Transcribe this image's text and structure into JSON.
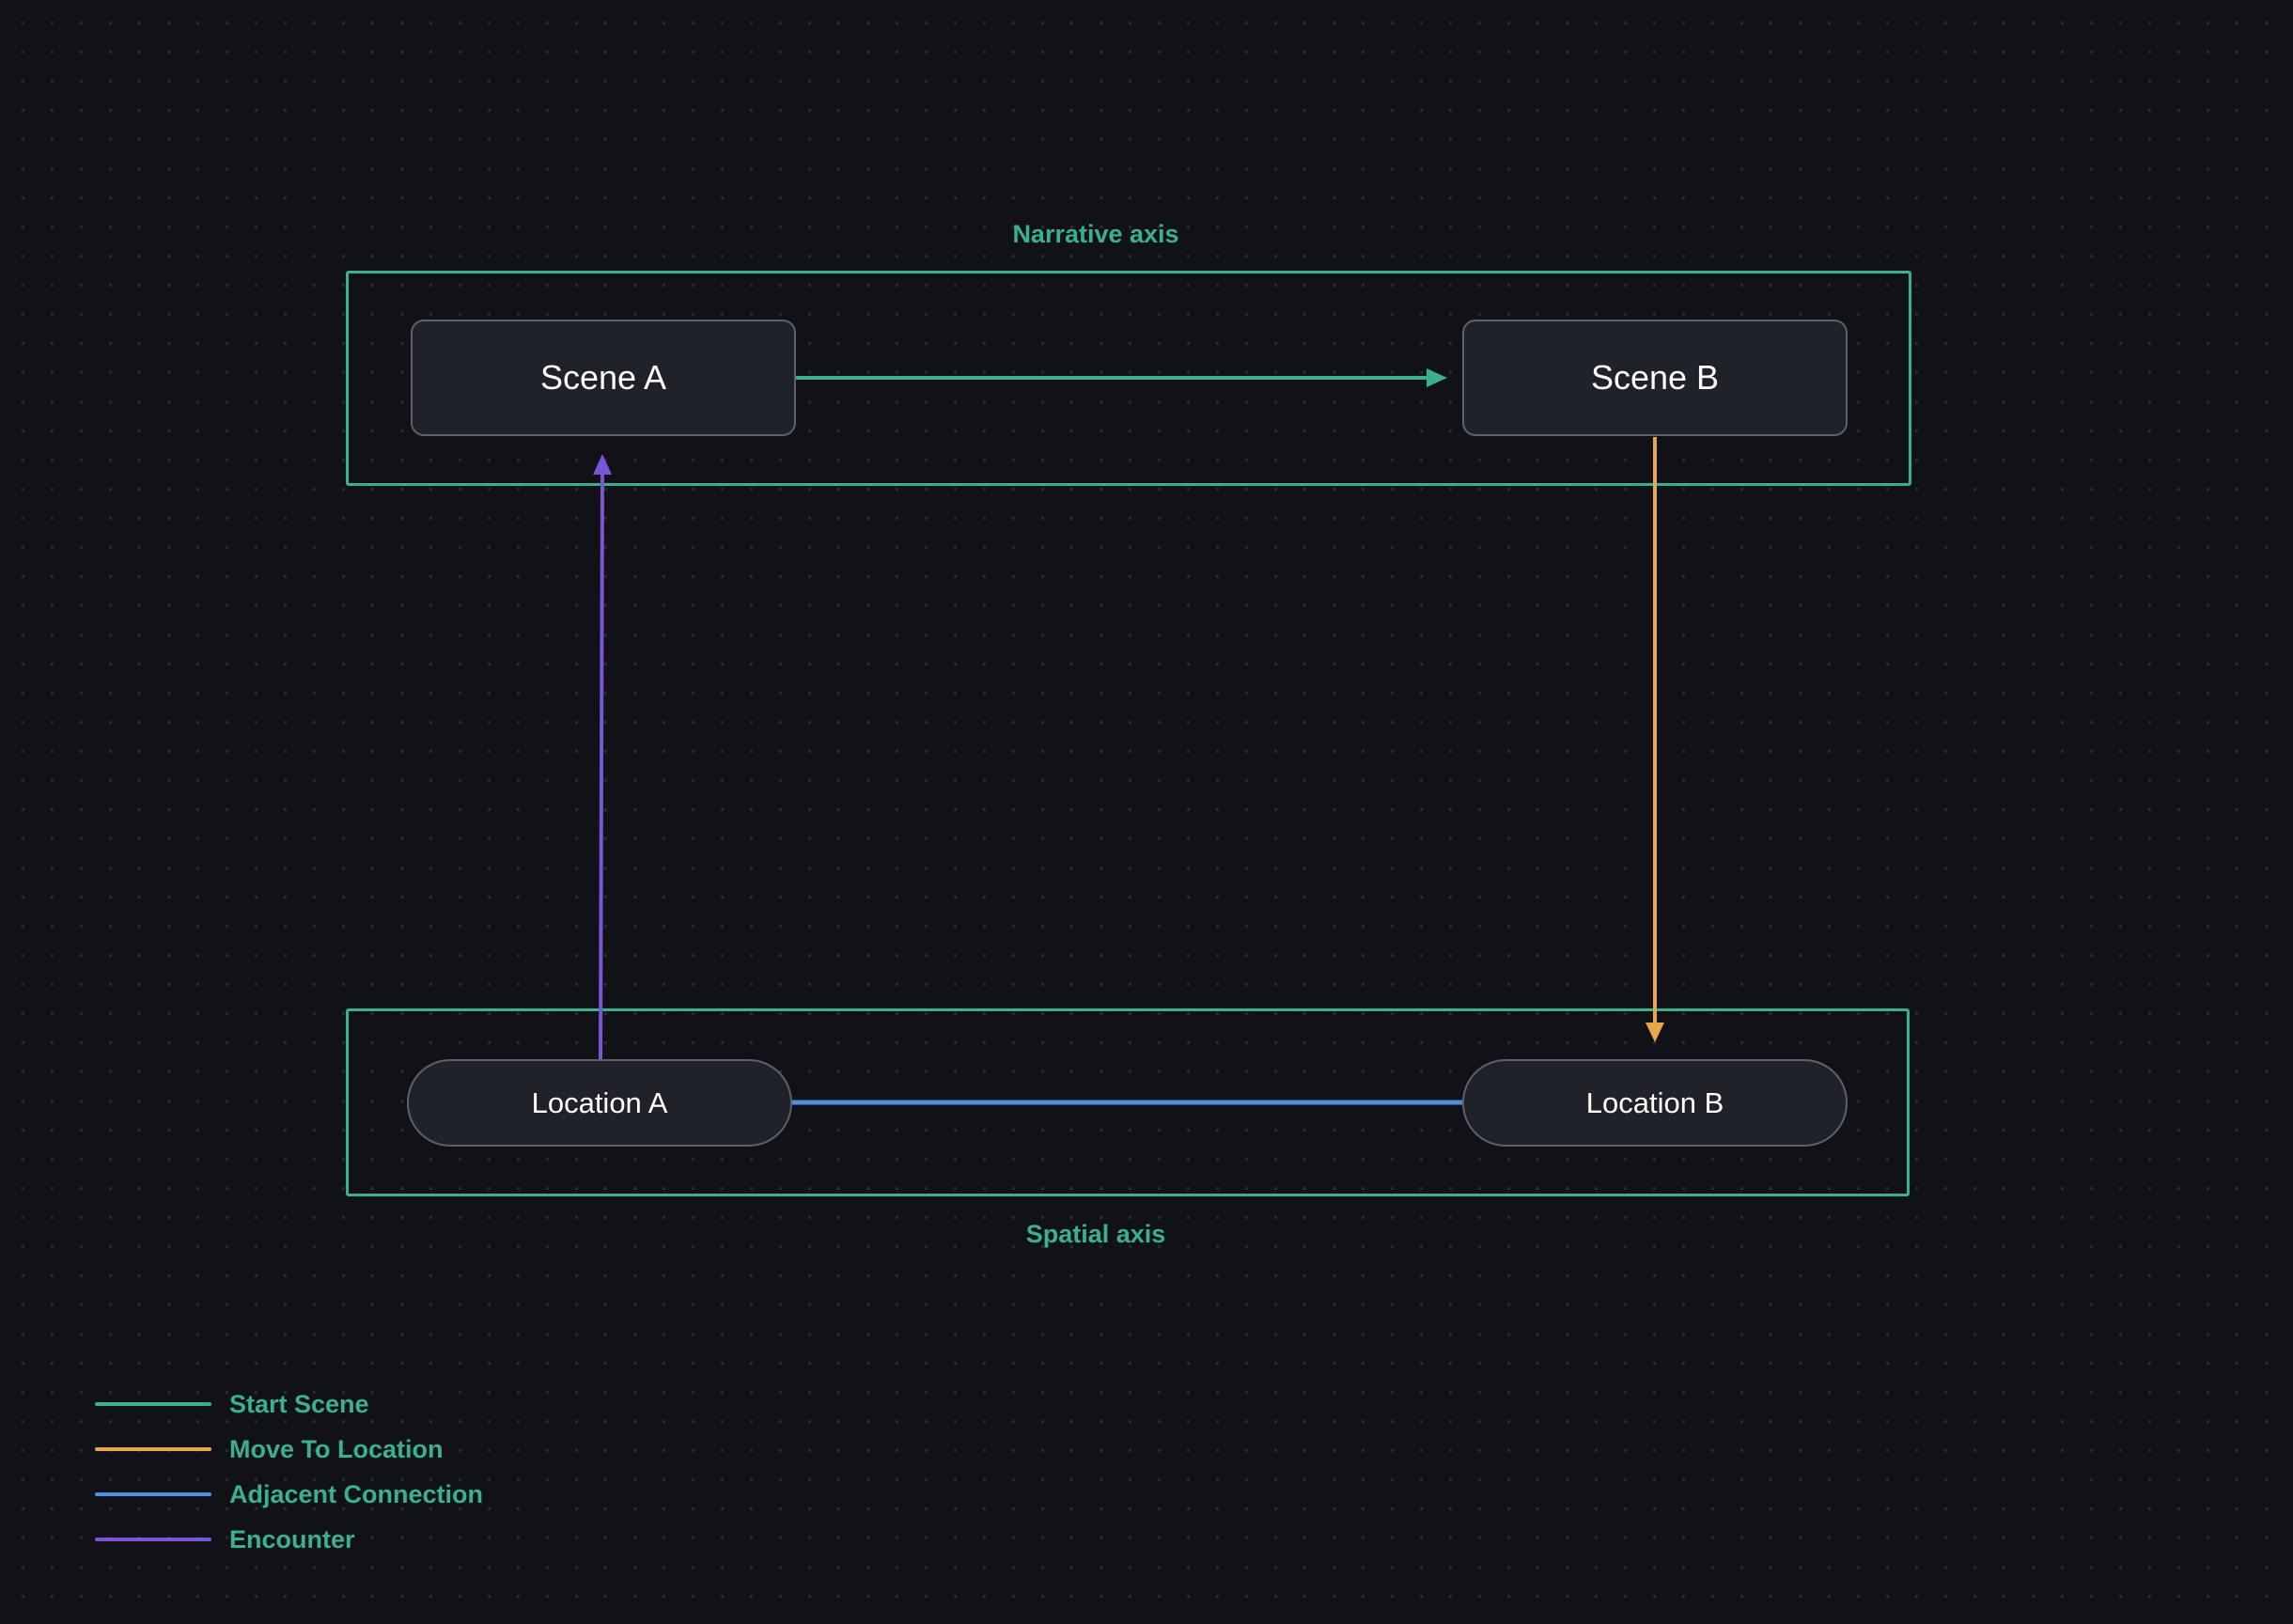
{
  "diagram": {
    "groups": {
      "narrative_label": "Narrative axis",
      "spatial_label": "Spatial axis",
      "border_color": "#3bb08f"
    },
    "nodes": {
      "scene_a": "Scene A",
      "scene_b": "Scene B",
      "location_a": "Location A",
      "location_b": "Location B"
    },
    "edges": [
      {
        "from": "Scene A",
        "to": "Scene B",
        "type": "Start Scene",
        "color": "#3bb08f",
        "arrow": true
      },
      {
        "from": "Scene B",
        "to": "Location B",
        "type": "Move To Location",
        "color": "#e8a54b",
        "arrow": true
      },
      {
        "from": "Location A",
        "to": "Location B",
        "type": "Adjacent Connection",
        "color": "#4f8fdf",
        "arrow": false
      },
      {
        "from": "Location A",
        "to": "Scene A",
        "type": "Encounter",
        "color": "#7b55d6",
        "arrow": true
      }
    ]
  },
  "legend": {
    "items": [
      {
        "label": "Start Scene",
        "color": "#3bb08f"
      },
      {
        "label": "Move To Location",
        "color": "#e8a54b"
      },
      {
        "label": "Adjacent Connection",
        "color": "#4f8fdf"
      },
      {
        "label": "Encounter",
        "color": "#7b55d6"
      }
    ]
  }
}
